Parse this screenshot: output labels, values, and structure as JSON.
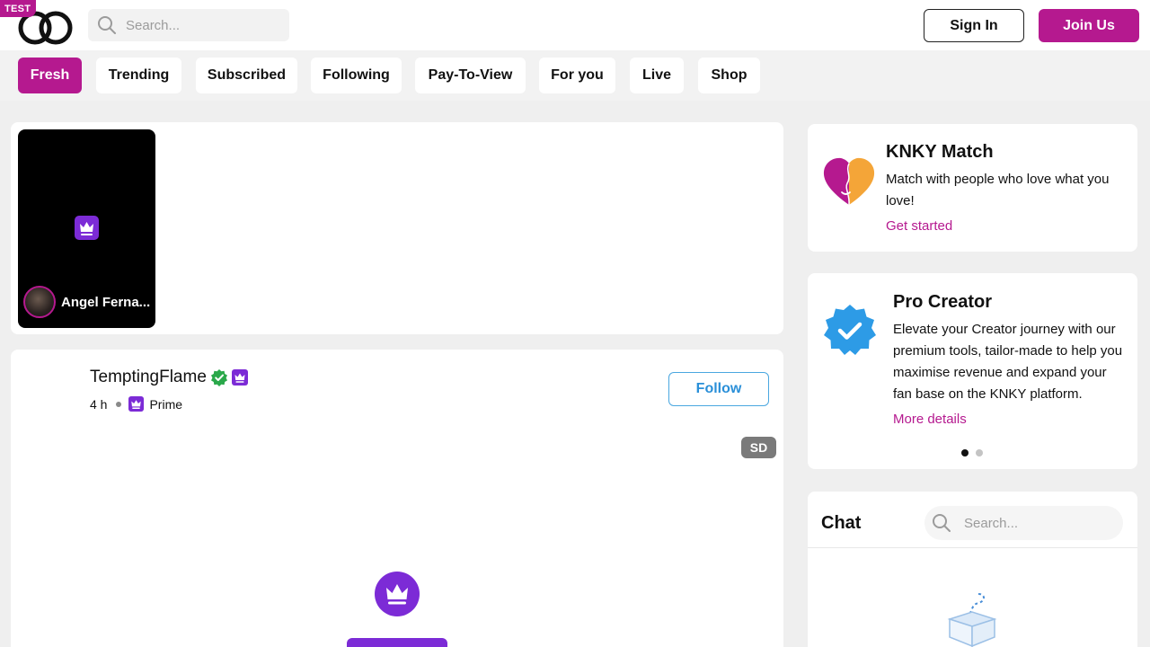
{
  "header": {
    "badge": "TEST",
    "logo": "knky-rings-logo",
    "search_placeholder": "Search...",
    "sign_in": "Sign In",
    "join": "Join Us"
  },
  "tabs": [
    {
      "label": "Fresh",
      "active": true
    },
    {
      "label": "Trending",
      "active": false
    },
    {
      "label": "Subscribed",
      "active": false
    },
    {
      "label": "Following",
      "active": false
    },
    {
      "label": "Pay-To-View",
      "active": false
    },
    {
      "label": "For you",
      "active": false
    },
    {
      "label": "Live",
      "active": false
    },
    {
      "label": "Shop",
      "active": false
    }
  ],
  "stories": [
    {
      "name": "Angel Fernandez",
      "display_name": "Angel Ferna..."
    }
  ],
  "post": {
    "author": "TemptingFlame",
    "age": "4 h",
    "tier": "Prime",
    "follow": "Follow",
    "quality": "SD"
  },
  "match_card": {
    "title": "KNKY Match",
    "text": "Match with people who love what you love!",
    "link": "Get started"
  },
  "pro_card": {
    "title": "Pro Creator",
    "text": "Elevate your Creator journey with our premium tools, tailor-made to help you maximise revenue and expand your fan base on the KNKY platform.",
    "link": "More details",
    "slides": 2,
    "active_slide": 1
  },
  "chat": {
    "title": "Chat",
    "search_placeholder": "Search..."
  },
  "colors": {
    "brand": "#b5198f",
    "prime": "#7c2bd6",
    "follow": "#2a8fd8",
    "verified": "#2aa84a",
    "pro_badge": "#2d9be6"
  }
}
